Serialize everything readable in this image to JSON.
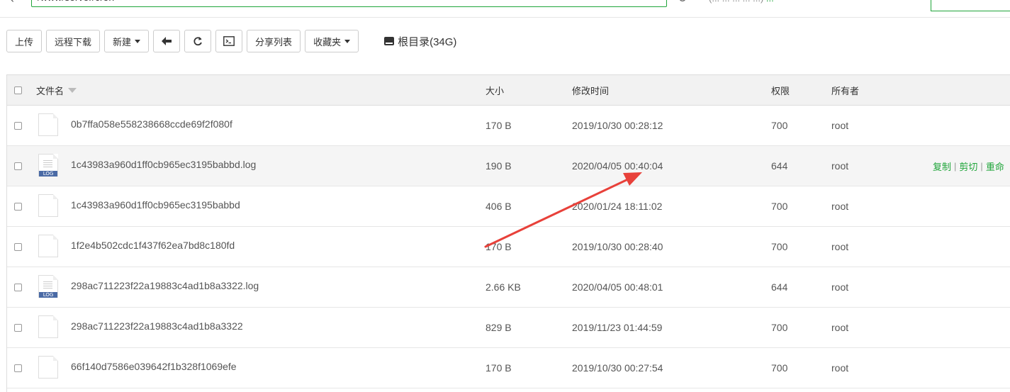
{
  "path_bar": {
    "path_value": "/www/server/cron",
    "info_text": "(... ... ... ... ...)",
    "info_highlight": "..."
  },
  "toolbar": {
    "upload_label": "上传",
    "remote_download_label": "远程下载",
    "new_label": "新建",
    "share_list_label": "分享列表",
    "favorites_label": "收藏夹",
    "root_dir_label": "根目录(34G)"
  },
  "table": {
    "headers": {
      "name": "文件名",
      "size": "大小",
      "modified": "修改时间",
      "permission": "权限",
      "owner": "所有者"
    },
    "rows": [
      {
        "name": "0b7ffa058e558238668ccde69f2f080f",
        "size": "170 B",
        "modified": "2019/10/30 00:28:12",
        "permission": "700",
        "owner": "root",
        "type": "file"
      },
      {
        "name": "1c43983a960d1ff0cb965ec3195babbd.log",
        "size": "190 B",
        "modified": "2020/04/05 00:40:04",
        "permission": "644",
        "owner": "root",
        "type": "log"
      },
      {
        "name": "1c43983a960d1ff0cb965ec3195babbd",
        "size": "406 B",
        "modified": "2020/01/24 18:11:02",
        "permission": "700",
        "owner": "root",
        "type": "file"
      },
      {
        "name": "1f2e4b502cdc1f437f62ea7bd8c180fd",
        "size": "170 B",
        "modified": "2019/10/30 00:28:40",
        "permission": "700",
        "owner": "root",
        "type": "file"
      },
      {
        "name": "298ac711223f22a19883c4ad1b8a3322.log",
        "size": "2.66 KB",
        "modified": "2020/04/05 00:48:01",
        "permission": "644",
        "owner": "root",
        "type": "log"
      },
      {
        "name": "298ac711223f22a19883c4ad1b8a3322",
        "size": "829 B",
        "modified": "2019/11/23 01:44:59",
        "permission": "700",
        "owner": "root",
        "type": "file"
      },
      {
        "name": "66f140d7586e039642f1b328f1069efe",
        "size": "170 B",
        "modified": "2019/10/30 00:27:54",
        "permission": "700",
        "owner": "root",
        "type": "file"
      }
    ],
    "row_actions": {
      "copy": "复制",
      "cut": "剪切",
      "rename": "重命"
    },
    "log_tag": "LOG"
  },
  "colors": {
    "accent": "#20a53a",
    "annotation": "#e8413a"
  },
  "icons": [
    "back-icon",
    "refresh-icon",
    "terminal-icon",
    "hdd-icon",
    "file-icon",
    "log-file-icon",
    "sort-caret-icon"
  ]
}
